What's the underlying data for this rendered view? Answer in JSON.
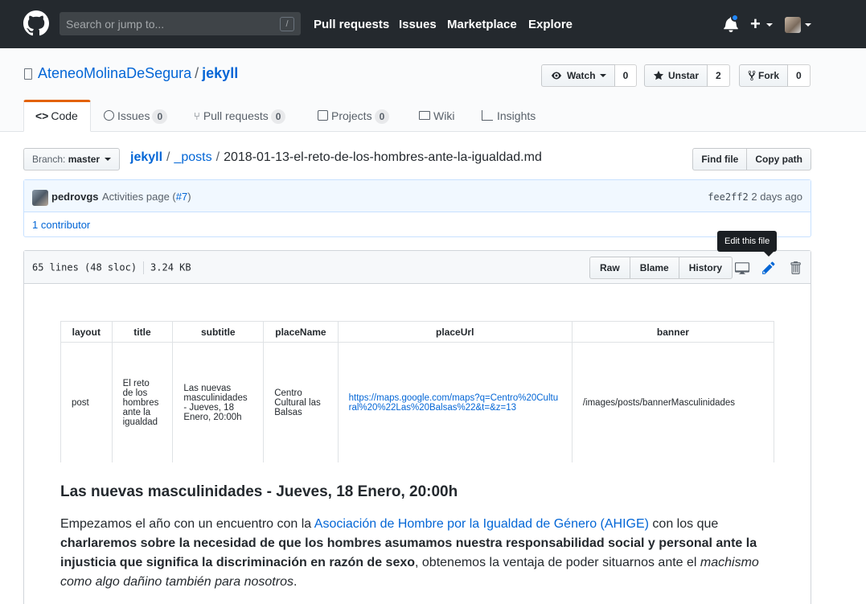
{
  "header": {
    "search_placeholder": "Search or jump to...",
    "search_key": "/",
    "nav": [
      "Pull requests",
      "Issues",
      "Marketplace",
      "Explore"
    ]
  },
  "repo": {
    "owner": "AteneoMolinaDeSegura",
    "separator": "/",
    "name": "jekyll",
    "watch_label": "Watch",
    "watch_count": "0",
    "star_label": "Unstar",
    "star_count": "2",
    "fork_label": "Fork",
    "fork_count": "0"
  },
  "tabs": [
    {
      "label": "Code"
    },
    {
      "label": "Issues",
      "count": "0"
    },
    {
      "label": "Pull requests",
      "count": "0"
    },
    {
      "label": "Projects",
      "count": "0"
    },
    {
      "label": "Wiki"
    },
    {
      "label": "Insights"
    }
  ],
  "file_nav": {
    "branch_prefix": "Branch:",
    "branch": "master",
    "path_root": "jekyll",
    "path_dir": "_posts",
    "file_name": "2018-01-13-el-reto-de-los-hombres-ante-la-igualdad.md",
    "find_file": "Find file",
    "copy_path": "Copy path"
  },
  "commit": {
    "author": "pedrovgs",
    "message": "Activities page (",
    "pr": "#7",
    "message_end": ")",
    "sha": "fee2ff2",
    "time": "2 days ago",
    "contributors": "1 contributor"
  },
  "file": {
    "lines": "65 lines (48 sloc)",
    "size": "3.24 KB",
    "raw": "Raw",
    "blame": "Blame",
    "history": "History",
    "tooltip": "Edit this file"
  },
  "front_matter": {
    "headers": [
      "layout",
      "title",
      "subtitle",
      "placeName",
      "placeUrl",
      "banner"
    ],
    "row": [
      "post",
      "El reto de los hombres ante la igualdad",
      "Las nuevas masculinidades - Jueves, 18 Enero, 20:00h",
      "Centro Cultural las Balsas",
      "https://maps.google.com/maps?q=Centro%20Cultural%20%22Las%20Balsas%22&t=&z=13",
      "/images/posts/bannerMasculinidades"
    ]
  },
  "content": {
    "heading": "Las nuevas masculinidades - Jueves, 18 Enero, 20:00h",
    "p1_start": "Empezamos el año con un encuentro con la ",
    "p1_link": "Asociación de Hombre por la Igualdad de Género (AHIGE)",
    "p1_mid": " con los que ",
    "p1_bold": "charlaremos sobre la necesidad de que los hombres asumamos nuestra responsabilidad social y personal ante la injusticia que significa la discriminación en razón de sexo",
    "p1_after": ", obtenemos la ventaja de poder situarnos ante el ",
    "p1_italic": "machismo como algo dañino también para nosotros",
    "p1_end": "."
  }
}
